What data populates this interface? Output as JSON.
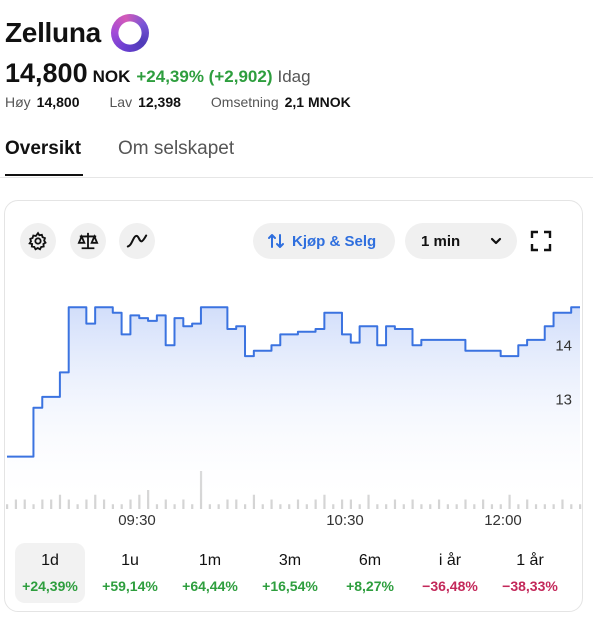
{
  "company": {
    "name": "Zelluna",
    "logo_icon": "company-logo-ring"
  },
  "quote": {
    "price": "14,800",
    "currency": "NOK",
    "change": "+24,39% (+2,902)",
    "period_label": "Idag"
  },
  "stats": [
    {
      "label": "Høy",
      "value": "14,800"
    },
    {
      "label": "Lav",
      "value": "12,398"
    },
    {
      "label": "Omsetning",
      "value": "2,1 MNOK"
    }
  ],
  "tabs": {
    "overview": "Oversikt",
    "about": "Om selskapet"
  },
  "toolbar": {
    "settings_icon": "gear-icon",
    "compare_icon": "scale-icon",
    "indicator_icon": "wave-icon",
    "trade_label": "Kjøp & Selg",
    "interval_label": "1 min",
    "fullscreen_icon": "expand-icon"
  },
  "colors": {
    "accent": "#2f6fde",
    "positive": "#2e9e3e",
    "negative": "#c3285a",
    "line": "#3b73e0"
  },
  "chart_data": {
    "type": "area",
    "x_ticks": [
      "09:30",
      "10:30",
      "12:00"
    ],
    "y_ticks": [
      "14",
      "13"
    ],
    "series": [
      {
        "values": [
          11.95,
          11.95,
          11.95,
          12.85,
          13.05,
          13.05,
          13.5,
          14.7,
          14.7,
          14.4,
          14.7,
          14.7,
          14.6,
          14.2,
          14.55,
          14.5,
          14.45,
          14.55,
          14.0,
          14.5,
          14.35,
          14.4,
          14.7,
          14.7,
          14.7,
          14.3,
          14.35,
          13.8,
          13.9,
          13.9,
          14.0,
          14.2,
          14.2,
          14.25,
          14.25,
          14.3,
          14.6,
          14.6,
          14.2,
          14.05,
          14.35,
          14.35,
          14.0,
          14.35,
          14.3,
          14.3,
          14.0,
          14.1,
          14.1,
          14.1,
          14.1,
          14.1,
          13.9,
          13.9,
          13.9,
          13.9,
          13.8,
          13.8,
          14.0,
          14.1,
          14.1,
          14.35,
          14.6,
          14.6,
          14.7,
          14.7
        ]
      }
    ],
    "ylim": [
      11.5,
      15.0
    ],
    "volume": [
      1,
      2,
      2,
      1,
      2,
      2,
      3,
      2,
      1,
      2,
      3,
      2,
      1,
      1,
      2,
      3,
      4,
      1,
      2,
      1,
      2,
      1,
      8,
      1,
      1,
      2,
      2,
      1,
      3,
      1,
      2,
      1,
      1,
      2,
      1,
      2,
      3,
      1,
      2,
      2,
      1,
      3,
      1,
      1,
      2,
      1,
      2,
      1,
      1,
      2,
      1,
      1,
      2,
      1,
      2,
      1,
      1,
      3,
      1,
      2,
      1,
      1,
      1,
      2,
      1,
      1
    ],
    "grid": false,
    "legend": "none"
  },
  "periods": [
    {
      "label": "1d",
      "change": "+24,39%",
      "sign": "pos",
      "active": true
    },
    {
      "label": "1u",
      "change": "+59,14%",
      "sign": "pos",
      "active": false
    },
    {
      "label": "1m",
      "change": "+64,44%",
      "sign": "pos",
      "active": false
    },
    {
      "label": "3m",
      "change": "+16,54%",
      "sign": "pos",
      "active": false
    },
    {
      "label": "6m",
      "change": "+8,27%",
      "sign": "pos",
      "active": false
    },
    {
      "label": "i år",
      "change": "−36,48%",
      "sign": "neg",
      "active": false
    },
    {
      "label": "1 år",
      "change": "−38,33%",
      "sign": "neg",
      "active": false
    },
    {
      "label": "",
      "change": "-",
      "sign": "neg",
      "active": false
    }
  ]
}
